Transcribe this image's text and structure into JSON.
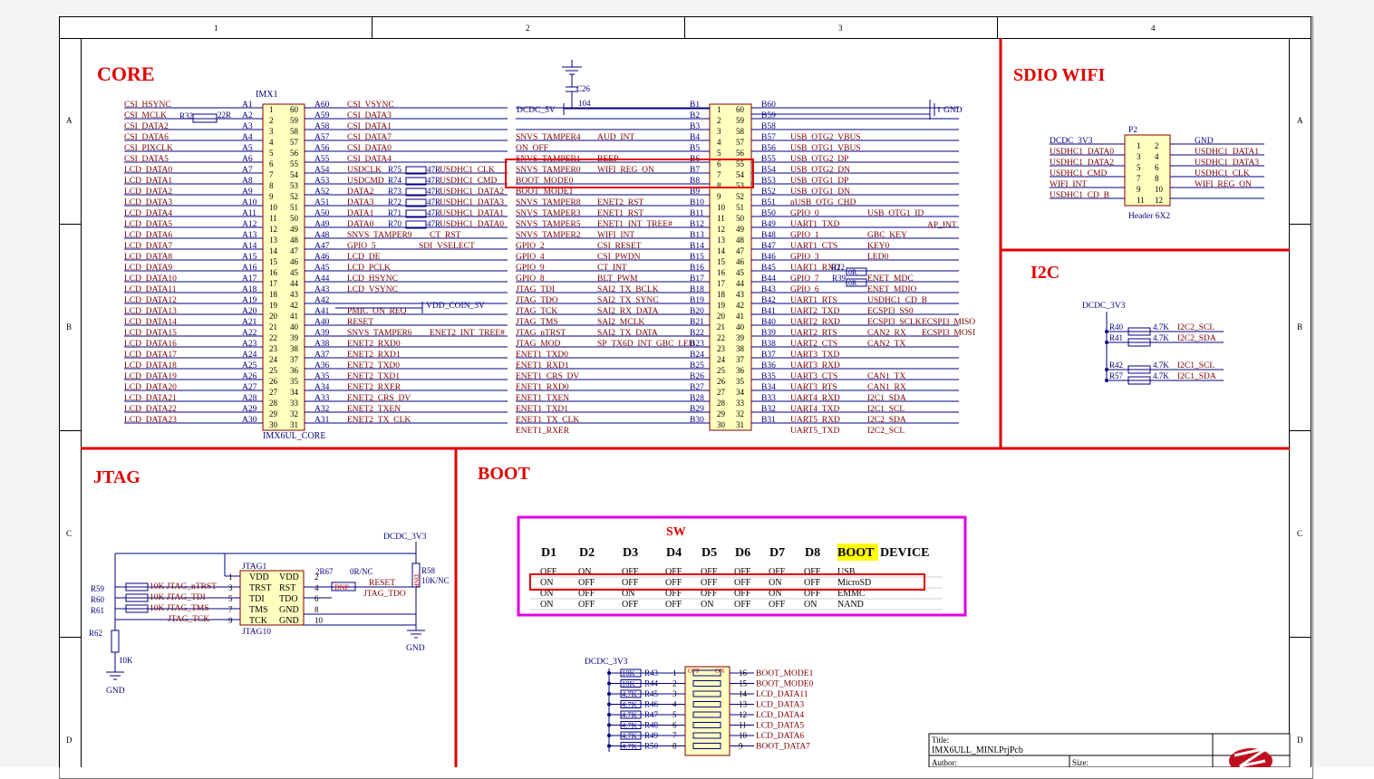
{
  "colors": {
    "wire": "#000080",
    "netlabel": "#800000",
    "section": "#e00000",
    "highlight_box": "#e00000",
    "boot_box": "#e000e0",
    "boot_hl": "#ffff00",
    "component_fill": "#ffffc0",
    "border": "#000000"
  },
  "border": {
    "columns": [
      "1",
      "2",
      "3",
      "4"
    ],
    "rows": [
      "A",
      "B",
      "C",
      "D"
    ]
  },
  "sections": {
    "core": "CORE",
    "sdio_wifi": "SDIO WIFI",
    "i2c": "I2C",
    "jtag": "JTAG",
    "boot": "BOOT"
  },
  "imx1": {
    "ref": "IMX1",
    "name": "IMX6UL_CORE",
    "left_nets": [
      "CSI_HSYNC",
      "CSI_MCLK",
      "CSI_DATA2",
      "CSI_DATA6",
      "CSI_PIXCLK",
      "CSI_DATA5",
      "LCD_DATA0",
      "LCD_DATA1",
      "LCD_DATA2",
      "LCD_DATA3",
      "LCD_DATA4",
      "LCD_DATA5",
      "LCD_DATA6",
      "LCD_DATA7",
      "LCD_DATA8",
      "LCD_DATA9",
      "LCD_DATA10",
      "LCD_DATA11",
      "LCD_DATA12",
      "LCD_DATA13",
      "LCD_DATA14",
      "LCD_DATA15",
      "LCD_DATA16",
      "LCD_DATA17",
      "LCD_DATA18",
      "LCD_DATA19",
      "LCD_DATA20",
      "LCD_DATA21",
      "LCD_DATA22",
      "LCD_DATA23"
    ],
    "a_pins": [
      "A1",
      "A2",
      "A3",
      "A4",
      "A5",
      "A6",
      "A7",
      "A8",
      "A9",
      "A10",
      "A11",
      "A12",
      "A13",
      "A14",
      "A15",
      "A16",
      "A17",
      "A18",
      "A19",
      "A20",
      "A21",
      "A22",
      "A23",
      "A24",
      "A25",
      "A26",
      "A27",
      "A28",
      "A29",
      "A30"
    ],
    "a_pins_r": [
      "A60",
      "A59",
      "A58",
      "A57",
      "A56",
      "A55",
      "A54",
      "A53",
      "A52",
      "A51",
      "A50",
      "A49",
      "A48",
      "A47",
      "A46",
      "A45",
      "A44",
      "A43",
      "A42",
      "A41",
      "A40",
      "A39",
      "A38",
      "A37",
      "A36",
      "A35",
      "A34",
      "A33",
      "A32",
      "A31"
    ],
    "right_nets": [
      "CSI_VSYNC",
      "CSI_DATA3",
      "CSI_DATA1",
      "CSI_DATA7",
      "CSI_DATA0",
      "CSI_DATA4",
      "USDCLK",
      "USDCMD",
      "DATA2",
      "DATA3",
      "DATA1",
      "DATA0",
      "SNVS_TAMPER9",
      "GPIO_5",
      "LCD_DE",
      "LCD_PCLK",
      "LCD_HSYNC",
      "LCD_VSYNC",
      "",
      "PMIC_ON_REQ",
      "RESET",
      "SNVS_TAMPER6",
      "ENET2_RXD0",
      "ENET2_RXD1",
      "ENET2_TXD0",
      "ENET2_TXD1",
      "ENET2_RXER",
      "ENET2_CRS_DV",
      "ENET2_TXEN",
      "ENET2_TX_CLK"
    ],
    "r32": "R32",
    "r32_val": "22R",
    "sd_res": [
      "R75",
      "R74",
      "R73",
      "R72",
      "R71",
      "R70"
    ],
    "sd_nets": [
      "USDHC1_CLK",
      "USDHC1_CMD",
      "USDHC1_DATA2",
      "USDHC1_DATA3",
      "USDHC1_DATA1",
      "USDHC1_DATA0"
    ],
    "sd_val": "47R",
    "ct_rst": "CT_RST",
    "sdi_vselect": "SDI_VSELECT",
    "vdd_coin": "VDD_COIN_3V",
    "enet2_int": "ENET2_INT_TREE#"
  },
  "b_conn": {
    "c26": "C26",
    "c26_val": "104",
    "dcdc": "DCDC_5V",
    "gnd": "GND",
    "left_nets": [
      "",
      "SNVS_TAMPER4",
      "ON_OFF",
      "SNVS_TAMPER1",
      "SNVS_TAMPER0",
      "BOOT_MODE0",
      "BOOT_MODE1",
      "SNVS_TAMPER8",
      "SNVS_TAMPER3",
      "SNVS_TAMPER5",
      "SNVS_TAMPER2",
      "GPIO_2",
      "GPIO_4",
      "GPIO_9",
      "GPIO_8",
      "JTAG_TDI",
      "JTAG_TDO",
      "JTAG_TCK",
      "JTAG_TMS",
      "JTAG_nTRST",
      "JTAG_MOD",
      "ENET1_TXD0",
      "ENET1_RXD1",
      "ENET1_CRS_DV",
      "ENET1_RXD0",
      "ENET1_TXEN",
      "ENET1_TXD1",
      "ENET1_TX_CLK",
      "ENET1_RXER"
    ],
    "mid_nets": [
      "",
      "AUD_INT",
      "",
      "BEEP",
      "WIFI_REG_ON",
      "",
      "",
      "ENET2_RST",
      "ENET1_RST",
      "ENET1_INT_TREE#",
      "WIFI_INT",
      "CSI_RESET",
      "CSI_PWDN",
      "CT_INT",
      "BLT_PWM",
      "SAI2_TX_BCLK",
      "SAI2_TX_SYNC",
      "SAI2_RX_DATA",
      "SAI2_MCLK",
      "SAI2_TX_DATA",
      "SP_TX6D_INT_GBC_LED",
      "",
      "",
      "",
      "",
      "",
      "",
      "",
      ""
    ],
    "b_pins": [
      "B1",
      "B2",
      "B3",
      "B4",
      "B5",
      "B6",
      "B7",
      "B8",
      "B9",
      "B10",
      "B11",
      "B12",
      "B13",
      "B14",
      "B15",
      "B16",
      "B17",
      "B18",
      "B19",
      "B20",
      "B21",
      "B22",
      "B23",
      "B24",
      "B25",
      "B26",
      "B27",
      "B28",
      "B29",
      "B30"
    ],
    "b_pins_r": [
      "B60",
      "B59",
      "B58",
      "B57",
      "B56",
      "B55",
      "B54",
      "B53",
      "B52",
      "B51",
      "B50",
      "B49",
      "B48",
      "B47",
      "B46",
      "B45",
      "B44",
      "B43",
      "B42",
      "B41",
      "B40",
      "B39",
      "B38",
      "B37",
      "B36",
      "B35",
      "B34",
      "B33",
      "B32",
      "B31"
    ],
    "right_nets": [
      "",
      "",
      "USB_OTG2_VBUS",
      "USB_OTG1_VBUS",
      "USB_OTG2_DP",
      "USB_OTG2_DN",
      "USB_OTG1_DP",
      "USB_OTG1_DN",
      "nUSB_OTG_CHD",
      "GPIO_0",
      "UART1_TXD",
      "GPIO_1",
      "UART1_CTS",
      "GPIO_3",
      "UART1_RXD",
      "GPIO_7",
      "GPIO_6",
      "UART1_RTS",
      "UART2_TXD",
      "UART2_RXD",
      "UART2_RTS",
      "UART2_CTS",
      "UART3_TXD",
      "UART3_RXD",
      "UART3_CTS",
      "UART3_RTS",
      "UART4_RXD",
      "UART4_TXD",
      "UART5_RXD",
      "UART5_TXD"
    ],
    "far_nets": [
      "",
      "",
      "",
      "",
      "",
      "",
      "",
      "",
      "",
      "USB_OTG1_ID",
      "",
      "GBC_KEY",
      "KEY0",
      "LED0",
      "",
      "ENET_MDC",
      "ENET_MDIO",
      "USDHC1_CD_B",
      "ECSPI3_SS0",
      "ECSPI3_SCLK",
      "CAN2_RX",
      "CAN2_TX",
      "",
      "",
      "CAN1_TX",
      "CAN1_RX",
      "I2C1_SDA",
      "I2C1_SCL",
      "I2C2_SDA",
      "I2C2_SCL"
    ],
    "ap_int": "AP_INT",
    "ecspi_miso": "ECSPI3_MISO",
    "ecspi_mosi": "ECSPI3_MOSI",
    "r22": "R22",
    "r39": "R39",
    "zero_r": "0R"
  },
  "p2": {
    "ref": "P2",
    "name": "Header 6X2",
    "dcdc": "DCDC_3V3",
    "left_nets": [
      "DCDC_3V3",
      "USDHC1_DATA0",
      "USDHC1_DATA2",
      "USDHC1_CMD",
      "WIFI_INT",
      "USDHC1_CD_B"
    ],
    "right_nets": [
      "GND",
      "USDHC1_DATA1",
      "USDHC1_DATA3",
      "USDHC1_CLK",
      "WIFI_REG_ON",
      ""
    ],
    "left_pins": [
      "1",
      "3",
      "5",
      "7",
      "9",
      "11"
    ],
    "right_pins": [
      "2",
      "4",
      "6",
      "8",
      "10",
      "12"
    ]
  },
  "i2c": {
    "dcdc": "DCDC_3V3",
    "res": [
      "R40",
      "R41",
      "R42",
      "R57"
    ],
    "val": "4.7K",
    "nets": [
      "I2C2_SCL",
      "I2C2_SDA",
      "I2C1_SCL",
      "I2C1_SDA"
    ]
  },
  "jtag": {
    "ref": "JTAG1",
    "name": "JTAG10",
    "dcdc": "DCDC_3V3",
    "left_res": [
      "R59",
      "R60",
      "R61"
    ],
    "left_nets": [
      "10K JTAG_nTRST",
      "10K JTAG_TDI",
      "10K JTAG_TMS",
      "JTAG_TCK"
    ],
    "pins_l": [
      "1",
      "3",
      "5",
      "7",
      "9"
    ],
    "pins_r": [
      "2",
      "4",
      "6",
      "8",
      "10"
    ],
    "labels_l": [
      "VDD",
      "TRST",
      "TDI",
      "TMS",
      "TCK"
    ],
    "labels_r": [
      "VDD",
      "RST",
      "TDO",
      "GND",
      "GND"
    ],
    "r67": "2R67",
    "r67_val": "0R/NC",
    "dnp": "DNP",
    "dnp2": "DNP",
    "reset": "RESET",
    "jtag_tdo": "JTAG_TDO",
    "r58": "R58",
    "r58_val": "10K/NC",
    "r62": "R62",
    "r62_val": "10K",
    "gnd": "GND"
  },
  "boot_table": {
    "title": "SW",
    "headers": [
      "D1",
      "D2",
      "D3",
      "D4",
      "D5",
      "D6",
      "D7",
      "D8"
    ],
    "hdr_boot": "BOOT",
    "hdr_device": "DEVICE",
    "rows": [
      [
        "OFF",
        "ON",
        "OFF",
        "OFF",
        "OFF",
        "OFF",
        "OFF",
        "OFF",
        "USB"
      ],
      [
        "ON",
        "OFF",
        "OFF",
        "OFF",
        "OFF",
        "OFF",
        "ON",
        "OFF",
        "MicroSD"
      ],
      [
        "ON",
        "OFF",
        "ON",
        "OFF",
        "OFF",
        "OFF",
        "ON",
        "OFF",
        "EMMC"
      ],
      [
        "ON",
        "OFF",
        "OFF",
        "OFF",
        "ON",
        "OFF",
        "OFF",
        "ON",
        "NAND"
      ]
    ]
  },
  "sw": {
    "dcdc": "DCDC_3V3",
    "res": [
      "R43",
      "R44",
      "R45",
      "R46",
      "R47",
      "R48",
      "R49",
      "R50"
    ],
    "vals": [
      "10K",
      "10K",
      "4.7K",
      "4.7K",
      "4.7K",
      "4.7K",
      "4.7K",
      "4.7K"
    ],
    "pins_l": [
      "1",
      "2",
      "3",
      "4",
      "5",
      "6",
      "7",
      "8"
    ],
    "pins_r": [
      "16",
      "15",
      "14",
      "13",
      "12",
      "11",
      "10",
      "9"
    ],
    "nets": [
      "BOOT_MODE1",
      "BOOT_MODE0",
      "LCD_DATA11",
      "LCD_DATA3",
      "LCD_DATA4",
      "LCD_DATA5",
      "LCD_DATA6",
      "BOOT_DATA7"
    ],
    "off": "OFF",
    "on": "ON"
  },
  "titleblock": {
    "title_label": "Title:",
    "title": "IMX6ULL_MINI.PrjPcb",
    "author_label": "Author:",
    "size_label": "Size:"
  }
}
